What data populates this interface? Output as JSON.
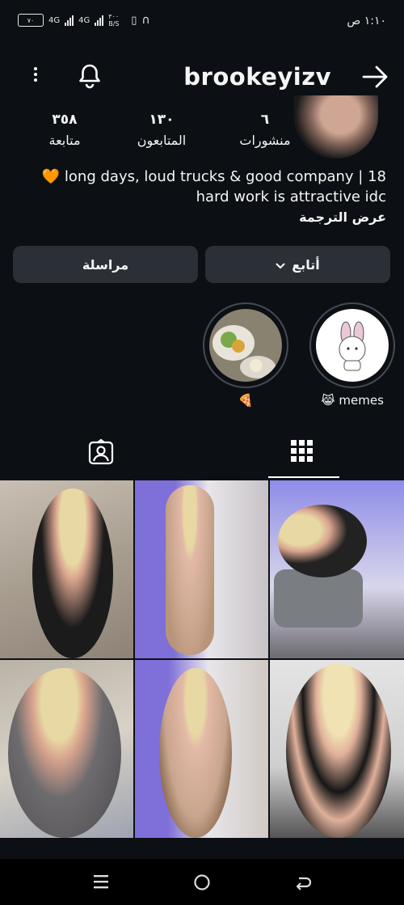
{
  "status_bar": {
    "time": "١:١٠ ص",
    "battery": "٧٠",
    "net1": "4G",
    "net2": "4G",
    "speed": "٣٠٠ B/S"
  },
  "header": {
    "username": "brookeyizv",
    "icons": [
      "more-vertical-icon",
      "bell-icon",
      "arrow-right-icon"
    ]
  },
  "stats": [
    {
      "value": "٦",
      "label": "منشورات"
    },
    {
      "value": "١٣٠",
      "label": "المتابعون"
    },
    {
      "value": "٣٥٨",
      "label": "متابعة"
    }
  ],
  "bio": {
    "line1": "🧡 long days, loud trucks & good company | 18",
    "line2": "hard work is attractive idc",
    "translate": "عرض الترجمة"
  },
  "buttons": {
    "follow": "أتابع",
    "message": "مراسلة"
  },
  "highlights": [
    {
      "label": "😹 memes"
    },
    {
      "label": "🍕"
    }
  ],
  "tabs": [
    "grid-icon",
    "tagged-icon"
  ],
  "colors": {
    "background": "#0c1014",
    "button": "#2b3036",
    "text": "#f5f5f5"
  }
}
